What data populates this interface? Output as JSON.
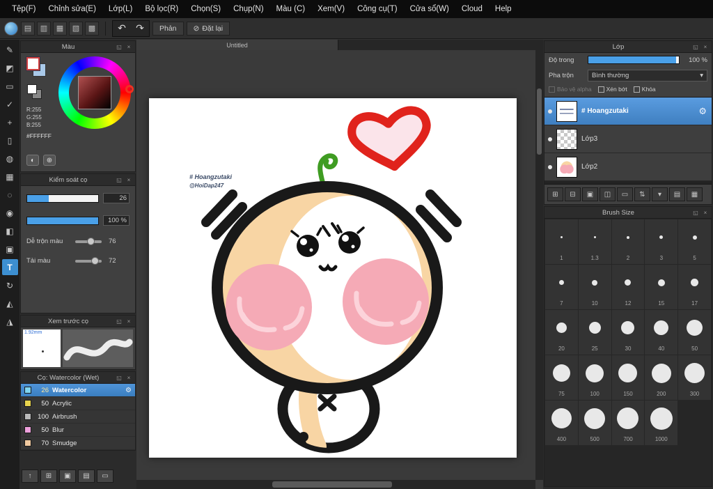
{
  "icons": {
    "gear": "⚙",
    "close": "×",
    "popout": "◱",
    "dropdown": "▾",
    "undo": "↶",
    "redo": "↷",
    "reset": "⊘"
  },
  "menu": {
    "items": [
      {
        "label": "Tệp(F)"
      },
      {
        "label": "Chỉnh sửa(E)"
      },
      {
        "label": "Lớp(L)"
      },
      {
        "label": "Bộ lọc(R)"
      },
      {
        "label": "Chọn(S)"
      },
      {
        "label": "Chụp(N)"
      },
      {
        "label": "Màu (C)"
      },
      {
        "label": "Xem(V)"
      },
      {
        "label": "Công cụ(T)"
      },
      {
        "label": "Cửa sổ(W)"
      },
      {
        "label": "Cloud"
      },
      {
        "label": "Help"
      }
    ]
  },
  "toolbar": {
    "flip_label": "Phản",
    "reset_label": "Đặt lại",
    "icons": [
      {
        "name": "paste-icon",
        "glyph": "▤"
      },
      {
        "name": "save-icon",
        "glyph": "▥"
      },
      {
        "name": "export-icon",
        "glyph": "▦"
      },
      {
        "name": "snap-settings-icon",
        "glyph": "▧"
      },
      {
        "name": "grid-toggle-icon",
        "glyph": "▩"
      }
    ]
  },
  "left_tools": [
    {
      "name": "pen-tool",
      "glyph": "✎"
    },
    {
      "name": "eraser-tool",
      "glyph": "◩"
    },
    {
      "name": "select-tool",
      "glyph": "▭"
    },
    {
      "name": "wand-tool",
      "glyph": "✓"
    },
    {
      "name": "move-tool",
      "glyph": "+"
    },
    {
      "name": "shape-tool",
      "glyph": "▯"
    },
    {
      "name": "fill-tool",
      "glyph": "◍"
    },
    {
      "name": "grid-tool",
      "glyph": "▦"
    },
    {
      "name": "lasso-tool",
      "glyph": "◌"
    },
    {
      "name": "eyedropper-tool",
      "glyph": "◉"
    },
    {
      "name": "gradient-tool",
      "glyph": "◧"
    },
    {
      "name": "stamp-tool",
      "glyph": "▣"
    },
    {
      "name": "text-tool",
      "glyph": "T",
      "active": true
    },
    {
      "name": "rotate-tool",
      "glyph": "↻"
    },
    {
      "name": "smudge-tool",
      "glyph": "◭"
    },
    {
      "name": "zoom-tool",
      "glyph": "◮"
    }
  ],
  "color_panel": {
    "title": "Màu",
    "r": "R:255",
    "g": "G:255",
    "b": "B:255",
    "hex": "#FFFFFF"
  },
  "brush_control": {
    "title": "Kiểm soát cọ",
    "size_value": "26",
    "opacity_value": "100 %",
    "mix_label": "Dễ trộn màu",
    "mix_value": "76",
    "load_label": "Tải màu",
    "load_value": "72"
  },
  "brush_preview": {
    "title": "Xem trước cọ",
    "size_label": "1.92mm"
  },
  "brush_list": {
    "title": "Cọ: Watercolor (Wet)",
    "items": [
      {
        "size": "26",
        "name": "Watercolor",
        "color": "#7fd4f0",
        "selected": true
      },
      {
        "size": "50",
        "name": "Acrylic",
        "color": "#e8d44d"
      },
      {
        "size": "100",
        "name": "Airbrush",
        "color": "#b9b9b9"
      },
      {
        "size": "50",
        "name": "Blur",
        "color": "#eda0dc"
      },
      {
        "size": "70",
        "name": "Smudge",
        "color": "#f0c9a0"
      }
    ]
  },
  "mini_toolbar": [
    {
      "name": "upload-brush-icon",
      "glyph": "↑"
    },
    {
      "name": "new-brush-icon",
      "glyph": "⊞"
    },
    {
      "name": "brush-menu-icon",
      "glyph": "▣"
    },
    {
      "name": "brush-set-icon",
      "glyph": "▤"
    },
    {
      "name": "brush-folder-icon",
      "glyph": "▭"
    }
  ],
  "canvas": {
    "tab": "Untitled",
    "signature_line1": "# Hoangzutaki",
    "signature_line2": "@HoiDap247"
  },
  "layer_panel": {
    "title": "Lớp",
    "opacity_label": "Độ trong",
    "opacity_value": "100 %",
    "blend_label": "Pha trộn",
    "blend_value": "Bình thường",
    "checkboxes": [
      {
        "label": "Bảo vệ alpha"
      },
      {
        "label": "Xén bớt"
      },
      {
        "label": "Khóa"
      }
    ],
    "layers": [
      {
        "name": "# Hoangzutaki",
        "selected": true
      },
      {
        "name": "Lớp3"
      },
      {
        "name": "Lớp2"
      }
    ],
    "toolbar_icons": [
      {
        "name": "new-layer-icon",
        "glyph": "⊞"
      },
      {
        "name": "remove-layer-icon",
        "glyph": "⊟"
      },
      {
        "name": "duplicate-layer-icon",
        "glyph": "▣"
      },
      {
        "name": "merge-layer-icon",
        "glyph": "◫"
      },
      {
        "name": "layer-folder-icon",
        "glyph": "▭"
      },
      {
        "name": "move-layer-icon",
        "glyph": "⇅"
      },
      {
        "name": "layer-menu-icon",
        "glyph": "▾"
      },
      {
        "name": "clear-layer-icon",
        "glyph": "▤"
      },
      {
        "name": "delete-layer-icon",
        "glyph": "▦"
      }
    ]
  },
  "brush_size_panel": {
    "title": "Brush Size",
    "sizes": [
      {
        "label": "1",
        "dot": 3
      },
      {
        "label": "1.3",
        "dot": 3
      },
      {
        "label": "2",
        "dot": 4
      },
      {
        "label": "3",
        "dot": 5
      },
      {
        "label": "5",
        "dot": 6
      },
      {
        "label": "7",
        "dot": 7
      },
      {
        "label": "10",
        "dot": 8
      },
      {
        "label": "12",
        "dot": 9
      },
      {
        "label": "15",
        "dot": 10
      },
      {
        "label": "17",
        "dot": 11
      },
      {
        "label": "20",
        "dot": 15
      },
      {
        "label": "25",
        "dot": 17
      },
      {
        "label": "30",
        "dot": 19
      },
      {
        "label": "40",
        "dot": 21
      },
      {
        "label": "50",
        "dot": 23
      },
      {
        "label": "75",
        "dot": 25
      },
      {
        "label": "100",
        "dot": 26
      },
      {
        "label": "150",
        "dot": 27
      },
      {
        "label": "200",
        "dot": 28
      },
      {
        "label": "300",
        "dot": 29
      },
      {
        "label": "400",
        "dot": 29
      },
      {
        "label": "500",
        "dot": 30
      },
      {
        "label": "700",
        "dot": 31
      },
      {
        "label": "1000",
        "dot": 32
      }
    ]
  }
}
